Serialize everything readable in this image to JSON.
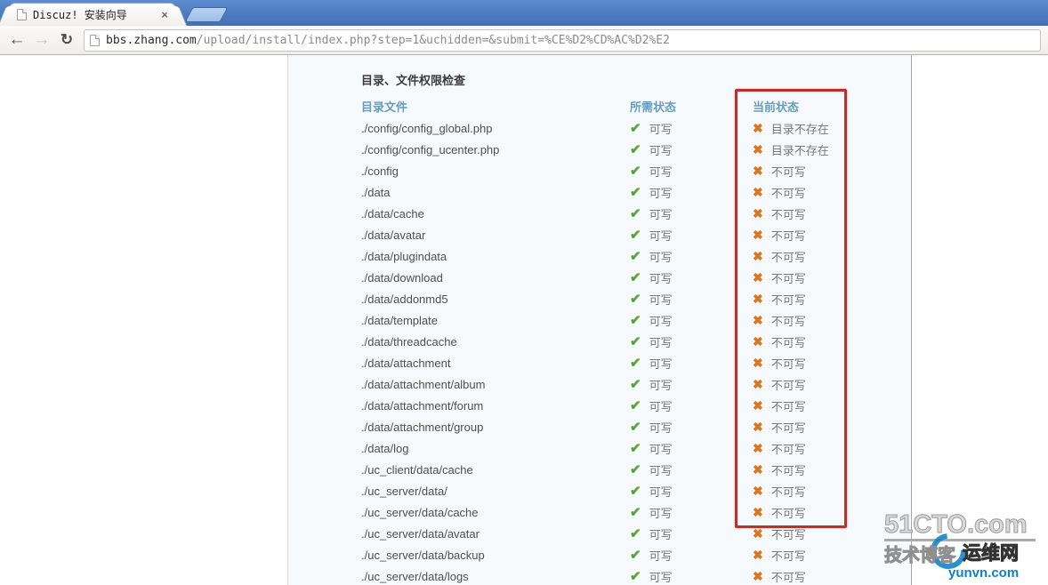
{
  "browser": {
    "tab": {
      "title": "Discuz! 安装向导",
      "close_icon": "×"
    },
    "nav": {
      "back_icon": "←",
      "forward_icon": "→",
      "reload_icon": "↻"
    },
    "address": {
      "url_host": "bbs.zhang.com",
      "url_rest": "/upload/install/index.php?step=1&uchidden=&submit=%CE%D2%CD%AC%D2%E2"
    }
  },
  "page": {
    "section_title": "目录、文件权限检查",
    "columns": {
      "file": "目录文件",
      "required": "所需状态",
      "current": "当前状态"
    },
    "icons": {
      "ok": "✔",
      "bad": "✖"
    },
    "colors": {
      "ok": "#55a538",
      "bad": "#e2731d",
      "header_blue": "#6a9cbd",
      "highlight_red": "#bb2f2f"
    },
    "rows": [
      {
        "path": "./config/config_global.php",
        "required": "可写",
        "current": "目录不存在"
      },
      {
        "path": "./config/config_ucenter.php",
        "required": "可写",
        "current": "目录不存在"
      },
      {
        "path": "./config",
        "required": "可写",
        "current": "不可写"
      },
      {
        "path": "./data",
        "required": "可写",
        "current": "不可写"
      },
      {
        "path": "./data/cache",
        "required": "可写",
        "current": "不可写"
      },
      {
        "path": "./data/avatar",
        "required": "可写",
        "current": "不可写"
      },
      {
        "path": "./data/plugindata",
        "required": "可写",
        "current": "不可写"
      },
      {
        "path": "./data/download",
        "required": "可写",
        "current": "不可写"
      },
      {
        "path": "./data/addonmd5",
        "required": "可写",
        "current": "不可写"
      },
      {
        "path": "./data/template",
        "required": "可写",
        "current": "不可写"
      },
      {
        "path": "./data/threadcache",
        "required": "可写",
        "current": "不可写"
      },
      {
        "path": "./data/attachment",
        "required": "可写",
        "current": "不可写"
      },
      {
        "path": "./data/attachment/album",
        "required": "可写",
        "current": "不可写"
      },
      {
        "path": "./data/attachment/forum",
        "required": "可写",
        "current": "不可写"
      },
      {
        "path": "./data/attachment/group",
        "required": "可写",
        "current": "不可写"
      },
      {
        "path": "./data/log",
        "required": "可写",
        "current": "不可写"
      },
      {
        "path": "./uc_client/data/cache",
        "required": "可写",
        "current": "不可写"
      },
      {
        "path": "./uc_server/data/",
        "required": "可写",
        "current": "不可写"
      },
      {
        "path": "./uc_server/data/cache",
        "required": "可写",
        "current": "不可写"
      },
      {
        "path": "./uc_server/data/avatar",
        "required": "可写",
        "current": "不可写"
      },
      {
        "path": "./uc_server/data/backup",
        "required": "可写",
        "current": "不可写"
      },
      {
        "path": "./uc_server/data/logs",
        "required": "可写",
        "current": "不可写"
      }
    ]
  },
  "watermark": {
    "line1": "51CTO.com",
    "line2": "技术博客",
    "line2b": "运维网",
    "line3": "yunvn.com"
  }
}
